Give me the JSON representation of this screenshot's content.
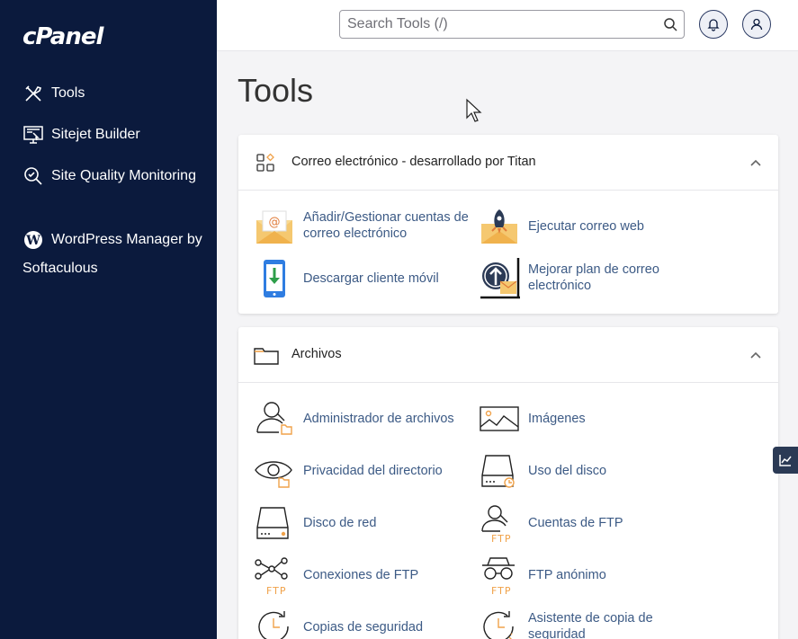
{
  "sidebar": {
    "logo": "cPanel",
    "items": [
      {
        "label": "Tools",
        "icon": "tools-icon"
      },
      {
        "label": "Sitejet Builder",
        "icon": "monitor-icon"
      },
      {
        "label": "Site Quality Monitoring",
        "icon": "quality-check-icon"
      },
      {
        "label": "WordPress Manager by Softaculous",
        "icon": "wordpress-icon"
      }
    ]
  },
  "header": {
    "search_placeholder": "Search Tools (/)"
  },
  "main": {
    "title": "Tools",
    "sections": [
      {
        "title": "Correo electrónico - desarrollado por Titan",
        "items": [
          {
            "label": "Añadir/Gestionar cuentas de correo electrónico",
            "icon": "email-at-icon"
          },
          {
            "label": "Ejecutar correo web",
            "icon": "webmail-rocket-icon"
          },
          {
            "label": "Descargar cliente móvil",
            "icon": "mobile-download-icon"
          },
          {
            "label": "Mejorar plan de correo electrónico",
            "icon": "upgrade-mail-icon"
          }
        ]
      },
      {
        "title": "Archivos",
        "items": [
          {
            "label": "Administrador de archivos",
            "icon": "file-manager-icon"
          },
          {
            "label": "Imágenes",
            "icon": "images-icon"
          },
          {
            "label": "Privacidad del directorio",
            "icon": "directory-privacy-icon"
          },
          {
            "label": "Uso del disco",
            "icon": "disk-usage-icon"
          },
          {
            "label": "Disco de red",
            "icon": "network-disk-icon"
          },
          {
            "label": "Cuentas de FTP",
            "icon": "ftp-accounts-icon"
          },
          {
            "label": "Conexiones de FTP",
            "icon": "ftp-connections-icon"
          },
          {
            "label": "FTP anónimo",
            "icon": "anonymous-ftp-icon"
          },
          {
            "label": "Copias de seguridad",
            "icon": "backup-icon"
          },
          {
            "label": "Asistente de copia de seguridad",
            "icon": "backup-wizard-icon"
          }
        ]
      }
    ]
  },
  "colors": {
    "sidebar_bg": "#0b1a3d",
    "link": "#3c5a85",
    "accent_orange": "#f0a24a"
  }
}
